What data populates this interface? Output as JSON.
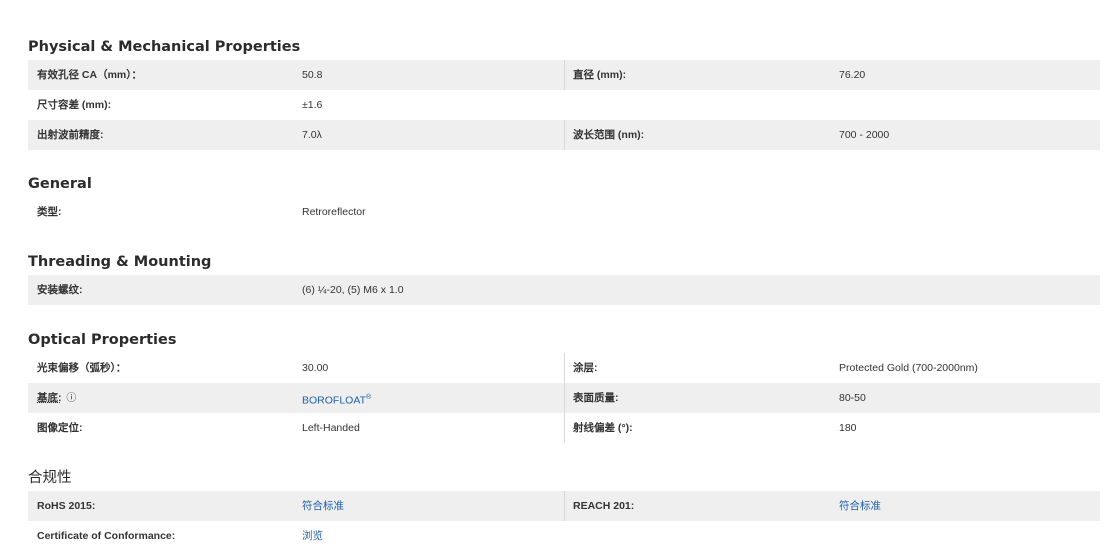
{
  "physical": {
    "title": "Physical & Mechanical Properties",
    "rows": [
      {
        "l1": "有效孔径 CA（mm）：",
        "v1": "50.8",
        "l2": "直径 (mm):",
        "v2": "76.20"
      },
      {
        "l1": "尺寸容差 (mm):",
        "v1": "±1.6"
      },
      {
        "l1": "出射波前精度:",
        "v1": "7.0λ",
        "l2": "波长范围 (nm):",
        "v2": "700 - 2000"
      }
    ]
  },
  "general": {
    "title": "General",
    "rows": [
      {
        "l1": "类型:",
        "v1": "Retroreflector"
      }
    ]
  },
  "threading": {
    "title": "Threading & Mounting",
    "rows": [
      {
        "l1": "安装螺纹:",
        "v1": "(6) ¼-20, (5) M6 x 1.0"
      }
    ]
  },
  "optical": {
    "title": "Optical Properties",
    "rows": [
      {
        "l1": "光束偏移（弧秒）：",
        "v1": "30.00",
        "l2": "涂层:",
        "v2": "Protected Gold (700-2000nm)"
      },
      {
        "l1": "基底:",
        "info": "ⓘ",
        "v1": "BOROFLOAT",
        "v1_sup": "®",
        "l2": "表面质量:",
        "v2": "80-50"
      },
      {
        "l1": "图像定位:",
        "v1": "Left-Handed",
        "l2": "射线偏差 (°):",
        "v2": "180"
      }
    ]
  },
  "compliance": {
    "title": "合规性",
    "rows": [
      {
        "l1": "RoHS 2015:",
        "v1": "符合标准",
        "l2": "REACH 201:",
        "v2": "符合标准"
      },
      {
        "l1": "Certificate of Conformance:",
        "v1": "浏览"
      }
    ]
  }
}
